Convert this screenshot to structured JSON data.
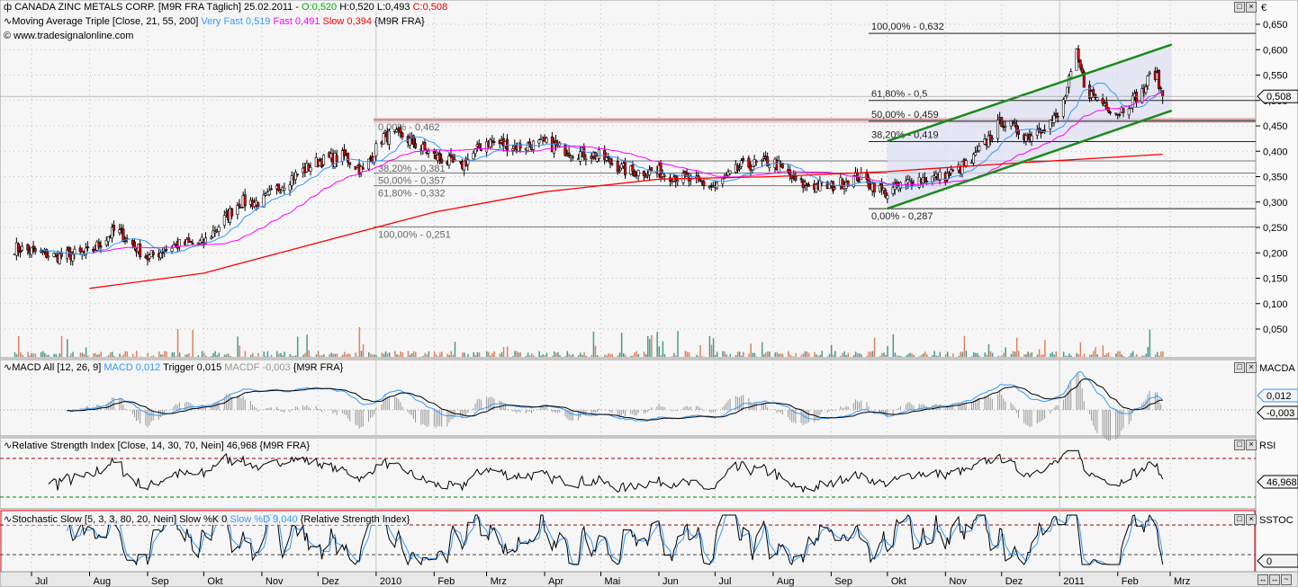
{
  "header": {
    "symbol_icon": "candle-icon",
    "title": "CANADA ZINC METALS CORP. [M9R FRA  Täglich] 25.02.2011 -",
    "open": "O:0,520",
    "high": "H:0,520",
    "low": "L:0,493",
    "close": "C:0,508",
    "ma_label": "Moving Average Triple [Close, 21, 55, 200]",
    "ma_very_fast": "Very Fast 0,519",
    "ma_fast": "Fast 0,491",
    "ma_slow": "Slow 0,394",
    "ma_suffix": "{M9R FRA}",
    "copyright": "www.tradesignalonline.com"
  },
  "colors": {
    "open": "#00b000",
    "close": "#e00000",
    "very_fast": "#3399ff",
    "fast": "#ff00ff",
    "slow": "#ff0000",
    "channel": "#1a8a1a",
    "fib_band": "#f0b0b0",
    "up": "#ffffff",
    "down": "#e00000"
  },
  "price_axis": {
    "currency": "€",
    "ticks": [
      "0,650",
      "0,600",
      "0,550",
      "0,500",
      "0,450",
      "0,400",
      "0,350",
      "0,300",
      "0,250",
      "0,200",
      "0,150",
      "0,100",
      "0,050"
    ],
    "last": "0,508"
  },
  "fib_left": [
    "0,00% - 0,462",
    "38,20% - 0,381",
    "50,00% - 0,357",
    "61,80% - 0,332",
    "100,00% - 0,251"
  ],
  "fib_right": [
    "100,00% - 0,632",
    "61,80% - 0,5",
    "50,00% - 0,459",
    "38,20% - 0,419",
    "0,00% - 0,287"
  ],
  "macd": {
    "label": "MACD All [12, 26, 9]",
    "macd": "MACD 0,012",
    "trigger": "Trigger 0,015",
    "macdf": "MACDF -0,003",
    "suffix": "{M9R FRA}",
    "axis": "MACDA",
    "tag1": "0,012",
    "tag2": "-0,003"
  },
  "rsi": {
    "label": "Relative Strength Index [Close, 14, 30, 70, Nein] 46,968 {M9R FRA}",
    "axis": "RSI",
    "tag": "46,968"
  },
  "stoch": {
    "label": "Stochastic Slow [5, 3, 3, 80, 20, Nein] Slow %K 0",
    "d": "Slow %D 9,040",
    "suffix": "{Relative Strength Index}",
    "axis": "SSTOC",
    "tag": "0"
  },
  "x_axis": [
    "Jul",
    "Aug",
    "Sep",
    "Okt",
    "Nov",
    "Dez",
    "2010",
    "Feb",
    "Mrz",
    "Apr",
    "Mai",
    "Jun",
    "Jul",
    "Aug",
    "Sep",
    "Okt",
    "Nov",
    "Dez",
    "2011",
    "Feb",
    "Mrz"
  ],
  "chart_data": {
    "type": "candlestick",
    "ylim": [
      0,
      0.66
    ],
    "close_anchors": [
      [
        "2009-06-22",
        0.21
      ],
      [
        "2009-07-15",
        0.193
      ],
      [
        "2009-08-01",
        0.2
      ],
      [
        "2009-08-15",
        0.246
      ],
      [
        "2009-09-01",
        0.19
      ],
      [
        "2009-09-15",
        0.215
      ],
      [
        "2009-10-01",
        0.22
      ],
      [
        "2009-10-20",
        0.3
      ],
      [
        "2009-11-01",
        0.3
      ],
      [
        "2009-11-15",
        0.344
      ],
      [
        "2009-12-01",
        0.38
      ],
      [
        "2009-12-15",
        0.39
      ],
      [
        "2009-12-25",
        0.36
      ],
      [
        "2010-01-05",
        0.43
      ],
      [
        "2010-01-15",
        0.43
      ],
      [
        "2010-02-01",
        0.39
      ],
      [
        "2010-02-15",
        0.37
      ],
      [
        "2010-03-01",
        0.42
      ],
      [
        "2010-03-15",
        0.41
      ],
      [
        "2010-04-01",
        0.415
      ],
      [
        "2010-04-15",
        0.4
      ],
      [
        "2010-05-01",
        0.39
      ],
      [
        "2010-05-15",
        0.36
      ],
      [
        "2010-06-01",
        0.36
      ],
      [
        "2010-06-15",
        0.345
      ],
      [
        "2010-07-01",
        0.33
      ],
      [
        "2010-07-15",
        0.37
      ],
      [
        "2010-08-01",
        0.38
      ],
      [
        "2010-08-15",
        0.335
      ],
      [
        "2010-09-01",
        0.33
      ],
      [
        "2010-09-15",
        0.35
      ],
      [
        "2010-10-01",
        0.317
      ],
      [
        "2010-10-15",
        0.345
      ],
      [
        "2010-11-01",
        0.35
      ],
      [
        "2010-11-15",
        0.38
      ],
      [
        "2010-12-01",
        0.46
      ],
      [
        "2010-12-15",
        0.43
      ],
      [
        "2011-01-01",
        0.47
      ],
      [
        "2011-01-10",
        0.59
      ],
      [
        "2011-01-15",
        0.52
      ],
      [
        "2011-02-01",
        0.476
      ],
      [
        "2011-02-15",
        0.52
      ],
      [
        "2011-02-20",
        0.565
      ],
      [
        "2011-02-25",
        0.508
      ]
    ],
    "slow_ma_anchors": [
      [
        "2009-08-01",
        0.13
      ],
      [
        "2009-10-01",
        0.16
      ],
      [
        "2009-12-01",
        0.22
      ],
      [
        "2010-02-01",
        0.28
      ],
      [
        "2010-04-01",
        0.32
      ],
      [
        "2010-06-01",
        0.345
      ],
      [
        "2010-08-01",
        0.35
      ],
      [
        "2010-10-01",
        0.36
      ],
      [
        "2010-12-01",
        0.375
      ],
      [
        "2011-02-25",
        0.394
      ]
    ],
    "fib_left_levels": [
      0.462,
      0.381,
      0.357,
      0.332,
      0.251
    ],
    "fib_right_levels": [
      0.632,
      0.5,
      0.459,
      0.419,
      0.287
    ],
    "channel": {
      "lower": [
        [
          "2010-10-01",
          0.287
        ],
        [
          "2011-02-25",
          0.48
        ]
      ],
      "upper": [
        [
          "2010-10-01",
          0.42
        ],
        [
          "2011-02-25",
          0.61
        ]
      ]
    }
  }
}
